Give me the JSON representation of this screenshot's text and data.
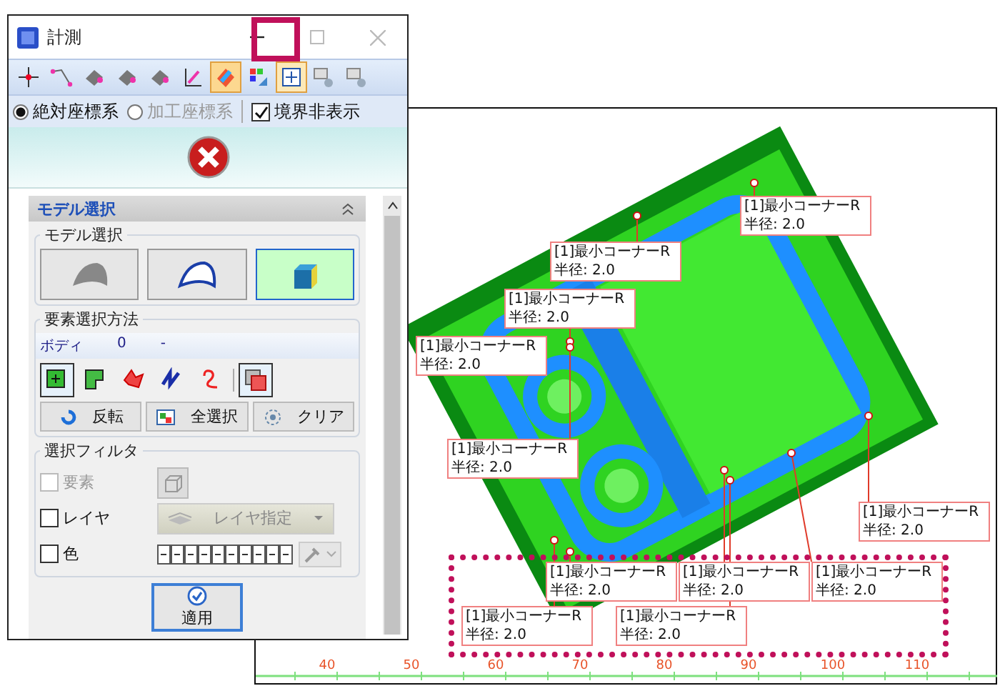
{
  "dialog": {
    "title": "計測"
  },
  "toolbar": [
    {
      "selected": false
    },
    {
      "selected": false
    },
    {
      "selected": false
    },
    {
      "selected": false
    },
    {
      "selected": false
    },
    {
      "selected": false
    },
    {
      "selected": true
    },
    {
      "selected": false
    },
    {
      "selected": true
    },
    {
      "selected": false
    },
    {
      "selected": false
    }
  ],
  "coordinate_options": [
    {
      "label": "絶対座標系",
      "selected": true,
      "disabled": false
    },
    {
      "label": "加工座標系",
      "selected": false,
      "disabled": true
    }
  ],
  "hide_boundary": {
    "label": "境界非表示",
    "checked": true
  },
  "panel": {
    "title": "モデル選択",
    "model_group": {
      "title": "モデル選択",
      "options": [
        {
          "selected": false
        },
        {
          "selected": false
        },
        {
          "selected": true
        }
      ]
    },
    "method_group": {
      "title": "要素選択方法",
      "info": [
        "ボディ",
        "0",
        "-"
      ],
      "tools": [
        {
          "on": true
        },
        {
          "on": false
        },
        {
          "on": false
        },
        {
          "on": false
        },
        {
          "on": false
        },
        {
          "on": true
        }
      ],
      "actions": [
        "反転",
        "全選択",
        "クリア"
      ]
    },
    "filter_group": {
      "title": "選択フィルタ",
      "rows": [
        {
          "kind": "cube",
          "label": "要素",
          "checked": false,
          "disabled": true
        },
        {
          "kind": "layer",
          "label": "レイヤ",
          "checked": false,
          "disabled": false,
          "control_label": "レイヤ指定"
        },
        {
          "kind": "color",
          "label": "色",
          "checked": false,
          "disabled": false
        }
      ]
    },
    "apply": "適用"
  },
  "viewport": {
    "callouts": [
      {
        "title": "[1]最小コーナーR",
        "value": "半径: 2.0"
      },
      {
        "title": "[1]最小コーナーR",
        "value": "半径: 2.0"
      },
      {
        "title": "[1]最小コーナーR",
        "value": "半径: 2.0"
      },
      {
        "title": "[1]最小コーナーR",
        "value": "半径: 2.0"
      },
      {
        "title": "[1]最小コーナーR",
        "value": "半径: 2.0"
      },
      {
        "title": "[1]最小コーナーR",
        "value": "半径: 2.0"
      },
      {
        "title": "[1]最小コーナーR",
        "value": "半径: 2.0"
      },
      {
        "title": "[1]最小コーナーR",
        "value": "半径: 2.0"
      },
      {
        "title": "[1]最小コーナーR",
        "value": "半径: 2.0"
      },
      {
        "title": "[1]最小コーナーR",
        "value": "半径: 2.0"
      },
      {
        "title": "[1]最小コーナーR",
        "value": "半径: 2.0"
      }
    ],
    "ruler": [
      "40",
      "50",
      "60",
      "70",
      "80",
      "90",
      "100",
      "110"
    ]
  }
}
